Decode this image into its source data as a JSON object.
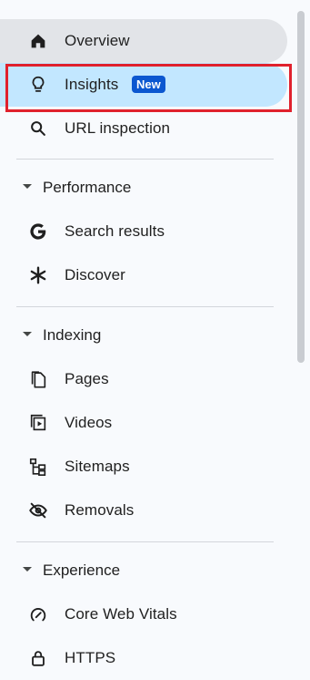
{
  "nav": {
    "overview": {
      "label": "Overview",
      "icon": "home-icon"
    },
    "insights": {
      "label": "Insights",
      "icon": "lightbulb-icon",
      "badge": "New"
    },
    "url_inspection": {
      "label": "URL inspection",
      "icon": "search-icon"
    },
    "performance": {
      "label": "Performance",
      "items": [
        {
          "label": "Search results",
          "icon": "google-g-icon"
        },
        {
          "label": "Discover",
          "icon": "asterisk-icon"
        }
      ]
    },
    "indexing": {
      "label": "Indexing",
      "items": [
        {
          "label": "Pages",
          "icon": "pages-icon"
        },
        {
          "label": "Videos",
          "icon": "video-page-icon"
        },
        {
          "label": "Sitemaps",
          "icon": "sitemap-icon"
        },
        {
          "label": "Removals",
          "icon": "eye-off-icon"
        }
      ]
    },
    "experience": {
      "label": "Experience",
      "items": [
        {
          "label": "Core Web Vitals",
          "icon": "gauge-icon"
        },
        {
          "label": "HTTPS",
          "icon": "lock-icon"
        }
      ]
    }
  },
  "colors": {
    "active_bg": "#c2e7ff",
    "hover_bg": "#e2e4e8",
    "badge_bg": "#0b57d0",
    "highlight_border": "#e0212d"
  }
}
